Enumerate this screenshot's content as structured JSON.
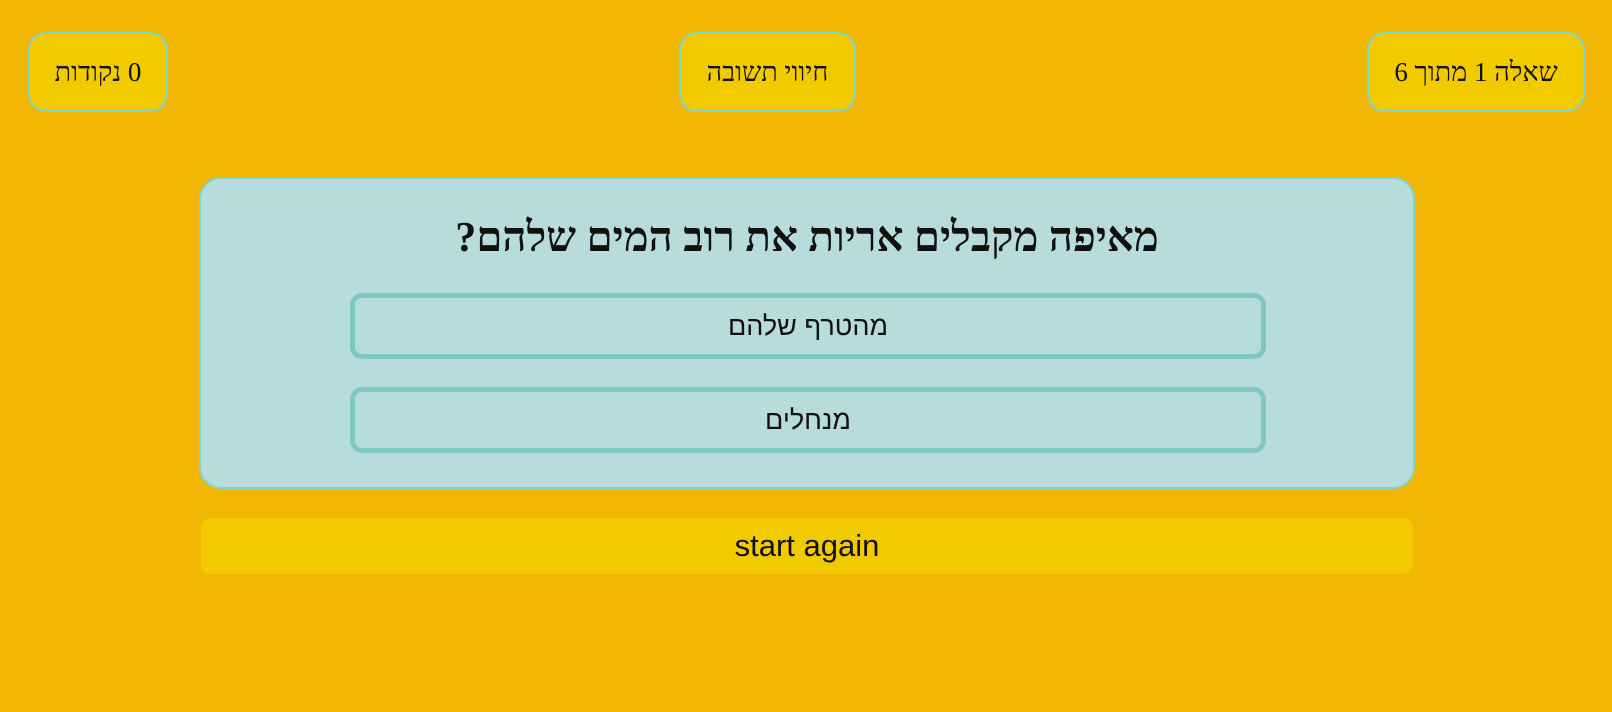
{
  "header": {
    "score": "0 נקודות",
    "feedback": "חיווי תשובה",
    "counter": "שאלה 1 מתוך 6"
  },
  "quiz": {
    "question": "מאיפה מקבלים אריות את רוב המים שלהם?",
    "answers": [
      "מהטרף שלהם",
      "מנחלים"
    ]
  },
  "controls": {
    "restart_label": "start again"
  },
  "colors": {
    "background": "#f2b705",
    "pill": "#f1ca00",
    "card": "#b8dbdb",
    "border_accent": "#7fd6d0",
    "answer_border": "#7ec8c0"
  }
}
